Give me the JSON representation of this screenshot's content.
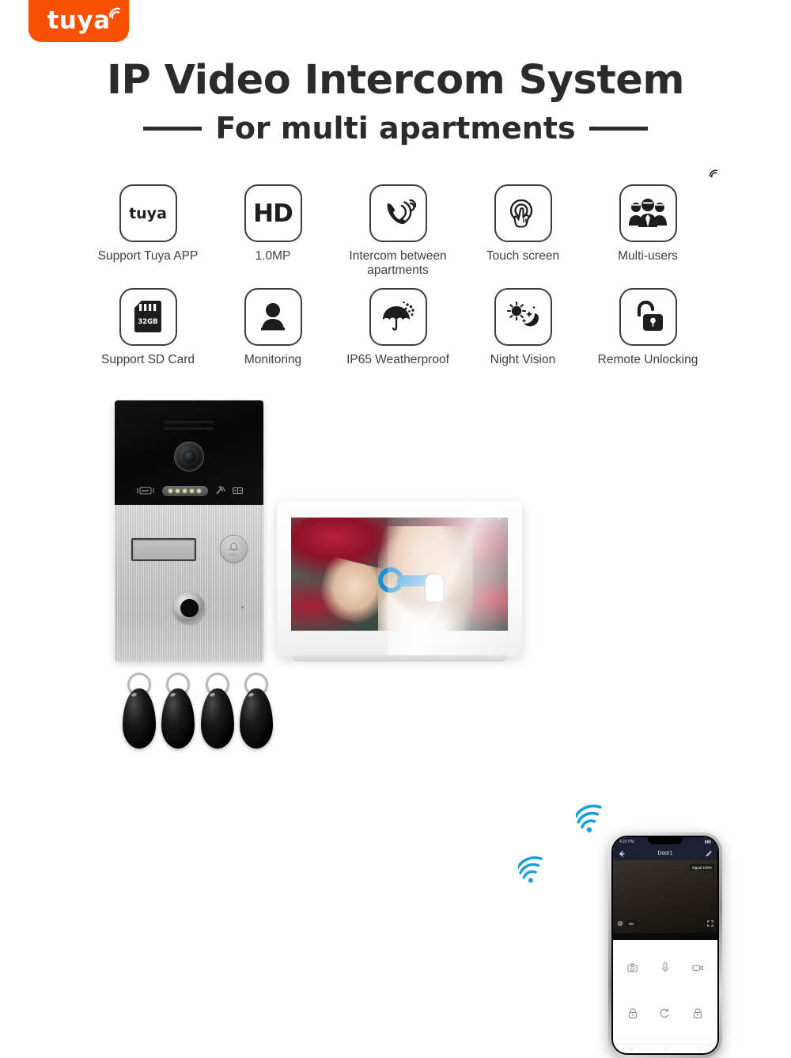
{
  "brand": {
    "badge_text": "tuya",
    "badge_color": "#f75000",
    "arc_icon": "wifi-arc-icon"
  },
  "header": {
    "title": "IP Video Intercom System",
    "subtitle": "For multi apartments",
    "title_color": "#2b2b2b"
  },
  "features": {
    "row1": [
      {
        "label": "Support Tuya APP",
        "icon": "tuya-logo-icon",
        "icon_text": "tuya"
      },
      {
        "label": "1.0MP",
        "icon": "hd-icon",
        "icon_text": "HD"
      },
      {
        "label": "Intercom between apartments",
        "icon": "phone-ringing-icon",
        "icon_text": ""
      },
      {
        "label": "Touch screen",
        "icon": "touch-hand-icon",
        "icon_text": ""
      },
      {
        "label": "Multi-users",
        "icon": "multi-users-icon",
        "icon_text": ""
      }
    ],
    "row2": [
      {
        "label": "Support SD Card",
        "icon": "sd-card-icon",
        "icon_text": "32GB"
      },
      {
        "label": "Monitoring",
        "icon": "person-monitor-icon",
        "icon_text": ""
      },
      {
        "label": "IP65 Weatherproof",
        "icon": "umbrella-rain-icon",
        "icon_text": ""
      },
      {
        "label": "Night Vision",
        "icon": "sun-moon-icon",
        "icon_text": ""
      },
      {
        "label": "Remote Unlocking",
        "icon": "open-padlock-icon",
        "icon_text": ""
      }
    ]
  },
  "door_station": {
    "name": "outdoor-door-station",
    "camera": "camera-lens",
    "call_button_label": "CALL",
    "call_button_icon": "bell-icon",
    "card_reader_icon": "rfid-card-icon",
    "led_count": 5,
    "nameplate": "",
    "fingerprint": "fingerprint-reader",
    "mic": "microphone-hole"
  },
  "key_fobs": {
    "name": "rfid-key-fobs",
    "count": 4
  },
  "monitor": {
    "name": "indoor-touch-monitor",
    "screen_content": "girl-among-red-flowers",
    "touch_indicator": "touch-gesture-icon"
  },
  "wifi_signals": {
    "count": 2,
    "color": "#1b9ad6"
  },
  "phone": {
    "name": "smartphone-tuya-app",
    "status_time": "4:25 PM",
    "header_title": "Door1",
    "back_icon": "back-arrow-icon",
    "edit_icon": "pencil-icon",
    "signal_badge": "Signal 100%",
    "quality_badge": "HD",
    "settings_icon": "gear-icon",
    "fullscreen_icon": "expand-icon",
    "controls": [
      {
        "icon": "camera-snapshot-icon",
        "name": "snapshot-button"
      },
      {
        "icon": "microphone-icon",
        "name": "talk-button"
      },
      {
        "icon": "video-record-icon",
        "name": "record-button"
      },
      {
        "icon": "padlock-icon",
        "name": "unlock-door-1-button"
      },
      {
        "icon": "refresh-switch-icon",
        "name": "switch-view-button"
      },
      {
        "icon": "padlock-icon",
        "name": "unlock-door-2-button"
      }
    ],
    "nav": [
      "◁",
      "○",
      "□"
    ]
  }
}
